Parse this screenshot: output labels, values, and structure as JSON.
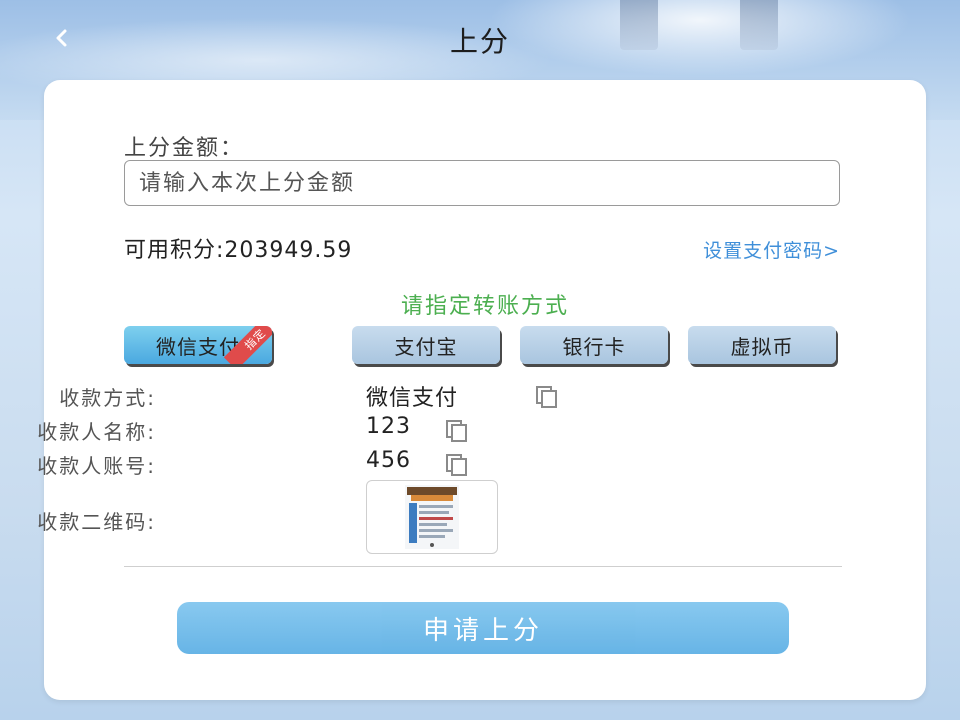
{
  "header": {
    "back_icon": "chevron-left-icon",
    "title": "上分"
  },
  "form": {
    "amount_label": "上分金额：",
    "amount_placeholder": "请输入本次上分金额",
    "amount_value": "",
    "available_points": "可用积分:203949.59",
    "set_pay_password": "设置支付密码>"
  },
  "transfer": {
    "hint": "请指定转账方式",
    "methods": [
      {
        "label": "微信支付",
        "selected": true,
        "badge": "指定"
      },
      {
        "label": "支付宝",
        "selected": false
      },
      {
        "label": "银行卡",
        "selected": false
      },
      {
        "label": "虚拟币",
        "selected": false
      }
    ]
  },
  "receiver": {
    "method_label": "收款方式:",
    "method_value": "微信支付",
    "name_label": "收款人名称:",
    "name_value": "123",
    "account_label": "收款人账号:",
    "account_value": "456",
    "qr_label": "收款二维码:"
  },
  "submit_label": "申请上分",
  "colors": {
    "accent_blue": "#3f8fd9",
    "hint_green": "#4caf50",
    "badge_red": "#e04b4b"
  }
}
